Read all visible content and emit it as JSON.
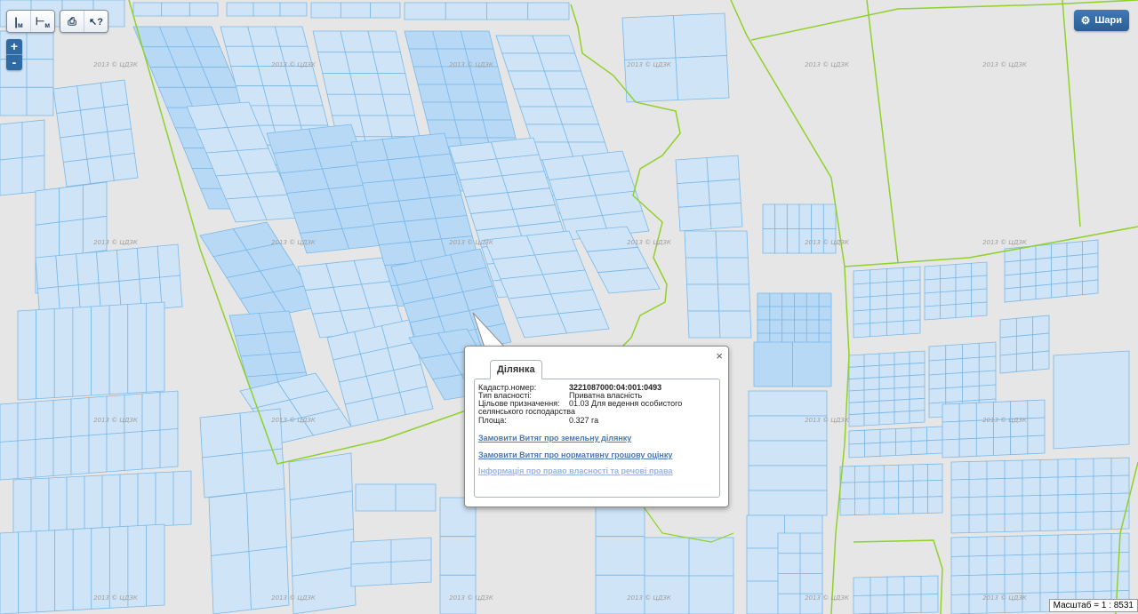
{
  "map": {
    "watermark": "2013 © ЦДЗК",
    "colors": {
      "background": "#e6e6e6",
      "parcel_fill": "#cfe4f7",
      "parcel_selected": "#b7d9f6",
      "parcel_stroke": "#7ab8e8",
      "boundary_green": "#8fd12a"
    }
  },
  "toolbar": {
    "measure_length_label": "м",
    "measure_area_label": "м",
    "print_icon": "print-icon",
    "identify_icon": "identify-cursor-icon"
  },
  "zoom": {
    "in_label": "+",
    "out_label": "-"
  },
  "layers_button": {
    "label": "Шари",
    "icon": "gear-icon"
  },
  "scale": {
    "label": "Масштаб = 1 : 8531"
  },
  "popup": {
    "close_label": "×",
    "tab_label": "Ділянка",
    "fields": [
      {
        "label": "Кадастр.номер:",
        "value": "3221087000:04:001:0493",
        "bold": true
      },
      {
        "label": "Тип власності:",
        "value": "Приватна власність",
        "bold": false
      },
      {
        "label": "Цільове призначення:",
        "value": "01.03 Для ведення особистого",
        "bold": false
      },
      {
        "label": "селянського господарства",
        "value": "",
        "bold": false
      },
      {
        "label": "Площа:",
        "value": "0.327 га",
        "bold": false
      }
    ],
    "links": [
      "Замовити Витяг про земельну ділянку",
      "Замовити Витяг про нормативну грошову оцінку",
      "Інформація про право власності та речові права"
    ]
  }
}
